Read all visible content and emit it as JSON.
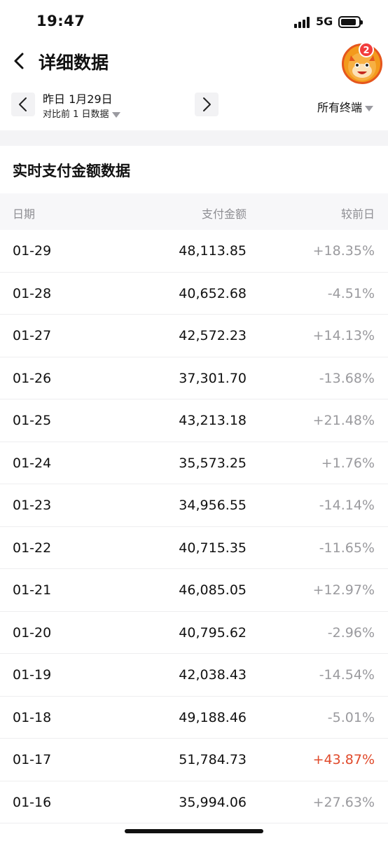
{
  "status_bar": {
    "time": "19:47",
    "network": "5G"
  },
  "header": {
    "title": "详细数据",
    "notification_count": "2"
  },
  "date_selector": {
    "main": "昨日 1月29日",
    "compare": "对比前 1 日数据",
    "terminal": "所有终端"
  },
  "section": {
    "title": "实时支付金额数据"
  },
  "table": {
    "headers": {
      "date": "日期",
      "amount": "支付金额",
      "change": "较前日"
    },
    "rows": [
      {
        "date": "01-29",
        "amount": "48,113.85",
        "change": "+18.35%"
      },
      {
        "date": "01-28",
        "amount": "40,652.68",
        "change": "-4.51%"
      },
      {
        "date": "01-27",
        "amount": "42,572.23",
        "change": "+14.13%"
      },
      {
        "date": "01-26",
        "amount": "37,301.70",
        "change": "-13.68%"
      },
      {
        "date": "01-25",
        "amount": "43,213.18",
        "change": "+21.48%"
      },
      {
        "date": "01-24",
        "amount": "35,573.25",
        "change": "+1.76%"
      },
      {
        "date": "01-23",
        "amount": "34,956.55",
        "change": "-14.14%"
      },
      {
        "date": "01-22",
        "amount": "40,715.35",
        "change": "-11.65%"
      },
      {
        "date": "01-21",
        "amount": "46,085.05",
        "change": "+12.97%"
      },
      {
        "date": "01-20",
        "amount": "40,795.62",
        "change": "-2.96%"
      },
      {
        "date": "01-19",
        "amount": "42,038.43",
        "change": "-14.54%"
      },
      {
        "date": "01-18",
        "amount": "49,188.46",
        "change": "-5.01%"
      },
      {
        "date": "01-17",
        "amount": "51,784.73",
        "change": "+43.87%",
        "highlight": true
      },
      {
        "date": "01-16",
        "amount": "35,994.06",
        "change": "+27.63%"
      }
    ]
  },
  "colors": {
    "highlight_change": "#e0492a",
    "muted_change": "#9a9a9e",
    "avatar": "#f39a1c",
    "badge": "#f23c3c"
  }
}
